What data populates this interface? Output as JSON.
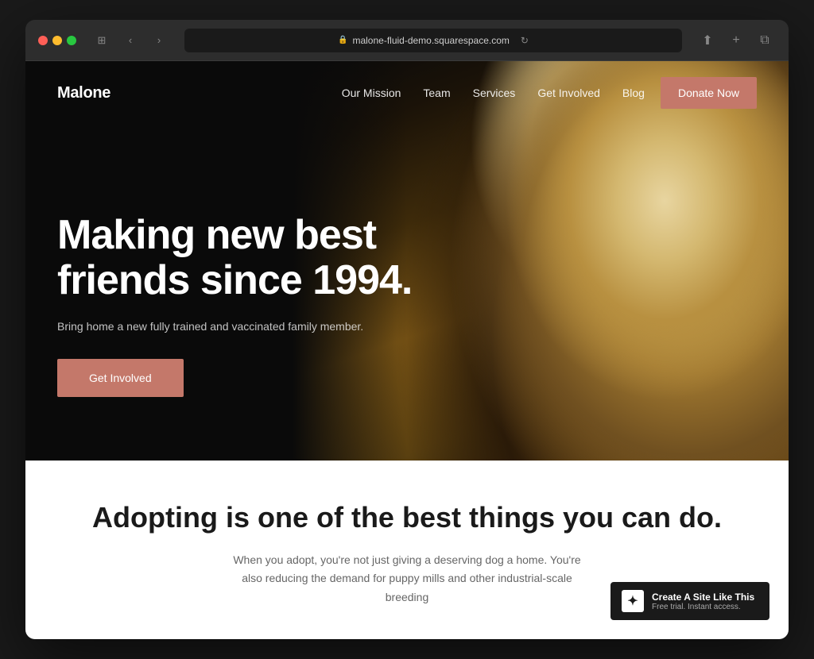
{
  "browser": {
    "url": "malone-fluid-demo.squarespace.com",
    "traffic_lights": [
      "red",
      "yellow",
      "green"
    ]
  },
  "nav": {
    "logo": "Malone",
    "links": [
      {
        "label": "Our Mission",
        "id": "our-mission"
      },
      {
        "label": "Team",
        "id": "team"
      },
      {
        "label": "Services",
        "id": "services"
      },
      {
        "label": "Get Involved",
        "id": "get-involved"
      },
      {
        "label": "Blog",
        "id": "blog"
      }
    ],
    "cta": "Donate Now"
  },
  "hero": {
    "title": "Making new best friends since 1994.",
    "subtitle": "Bring home a new fully trained and vaccinated family member.",
    "cta": "Get Involved"
  },
  "bottom": {
    "title": "Adopting is one of the best things you can do.",
    "body": "When you adopt, you're not just giving a deserving dog a home. You're also reducing the demand for puppy mills and other industrial-scale breeding"
  },
  "badge": {
    "title": "Create A Site Like This",
    "subtitle": "Free trial. Instant access.",
    "icon": "✦"
  }
}
